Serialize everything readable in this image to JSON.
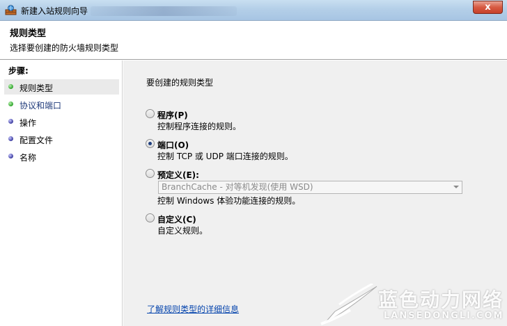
{
  "window": {
    "title": "新建入站规则向导",
    "close_label": "x"
  },
  "header": {
    "title": "规则类型",
    "subtitle": "选择要创建的防火墙规则类型"
  },
  "steps": {
    "title": "步骤:",
    "items": [
      {
        "label": "规则类型",
        "status": "completed",
        "dot_color": "green"
      },
      {
        "label": "协议和端口",
        "status": "current",
        "dot_color": "green"
      },
      {
        "label": "操作",
        "status": "pending",
        "dot_color": "blue"
      },
      {
        "label": "配置文件",
        "status": "pending",
        "dot_color": "blue"
      },
      {
        "label": "名称",
        "status": "pending",
        "dot_color": "blue"
      }
    ]
  },
  "content": {
    "prompt": "要创建的规则类型",
    "options": [
      {
        "label": "程序(P)",
        "desc": "控制程序连接的规则。",
        "checked": false
      },
      {
        "label": "端口(O)",
        "desc": "控制 TCP 或 UDP 端口连接的规则。",
        "checked": true
      },
      {
        "label": "预定义(E):",
        "desc": "控制 Windows 体验功能连接的规则。",
        "checked": false
      },
      {
        "label": "自定义(C)",
        "desc": "自定义规则。",
        "checked": false
      }
    ],
    "predefined_select_value": "BranchCache - 对等机发现(使用 WSD)",
    "help_link": "了解规则类型的详细信息"
  },
  "watermark": {
    "text_cn": "蓝色动力网络",
    "text_en": "LANSEDONGLI.COM"
  },
  "colors": {
    "link": "#0645ad",
    "selected_radio": "#1f3f7f",
    "panel_bg": "#f0f0f0",
    "step_green": "#2ea42a",
    "step_blue": "#3a3a9e"
  }
}
